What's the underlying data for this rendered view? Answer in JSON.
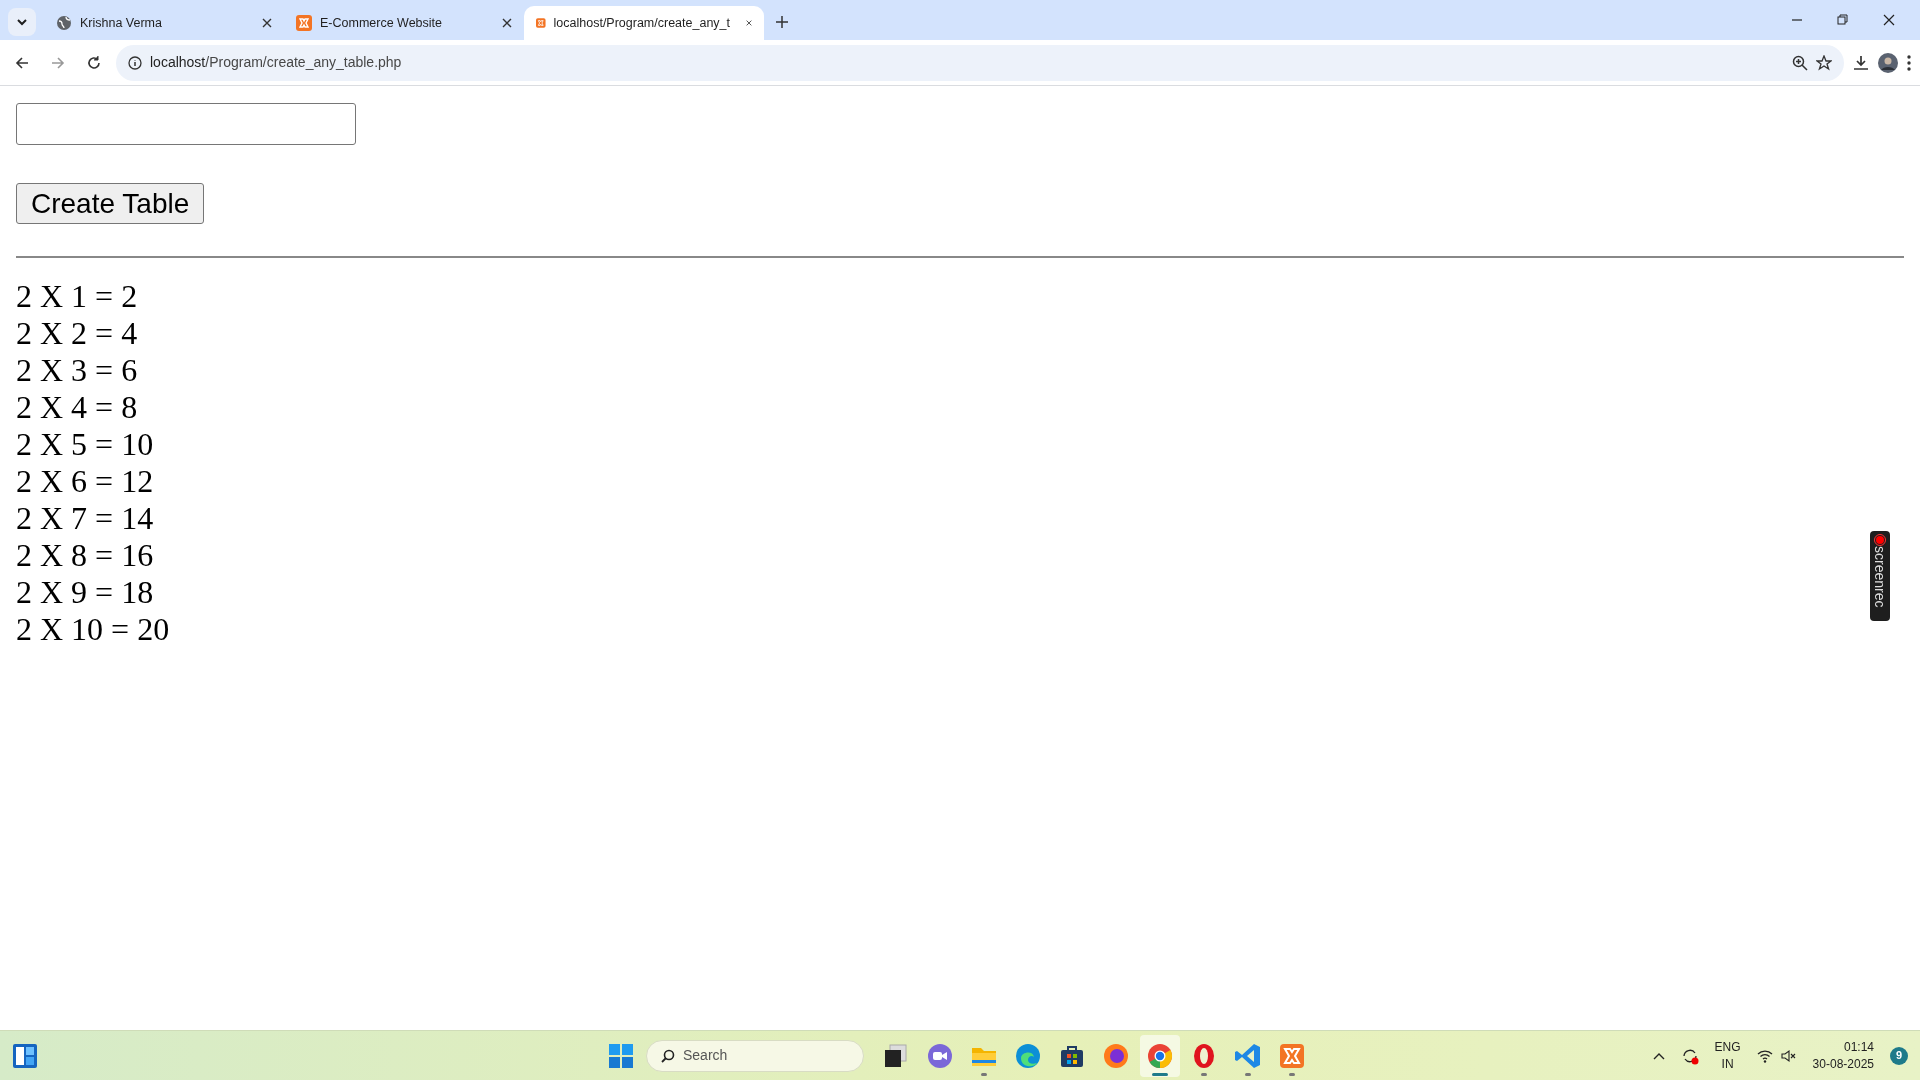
{
  "browser": {
    "tabs": [
      {
        "title": "Krishna Verma",
        "kind": "globe",
        "selected": false
      },
      {
        "title": "E-Commerce Website",
        "kind": "xampp",
        "selected": false
      },
      {
        "title": "localhost/Program/create_any_t",
        "kind": "xampp",
        "selected": true
      }
    ],
    "address": {
      "host": "localhost",
      "path": "/Program/create_any_table.php"
    }
  },
  "page": {
    "button": "Create Table",
    "lines": [
      "2 X 1 = 2",
      "2 X 2 = 4",
      "2 X 3 = 6",
      "2 X 4 = 8",
      "2 X 5 = 10",
      "2 X 6 = 12",
      "2 X 7 = 14",
      "2 X 8 = 16",
      "2 X 9 = 18",
      "2 X 10 = 20"
    ]
  },
  "overlay": {
    "label": "screenrec"
  },
  "taskbar": {
    "search_placeholder": "Search",
    "apps": [
      {
        "kind": "taskview",
        "running": false,
        "active": false
      },
      {
        "kind": "meet",
        "running": false,
        "active": false
      },
      {
        "kind": "folder",
        "running": true,
        "active": false
      },
      {
        "kind": "edge",
        "running": false,
        "active": false
      },
      {
        "kind": "store",
        "running": false,
        "active": false
      },
      {
        "kind": "firefox",
        "running": false,
        "active": false
      },
      {
        "kind": "chrome",
        "running": true,
        "active": true
      },
      {
        "kind": "opera",
        "running": true,
        "active": false
      },
      {
        "kind": "vscode",
        "running": true,
        "active": false
      },
      {
        "kind": "xampp",
        "running": true,
        "active": false
      }
    ],
    "tray": {
      "language": "ENG",
      "region": "IN",
      "time": "01:14",
      "date": "30-08-2025",
      "notifications": "9"
    }
  }
}
